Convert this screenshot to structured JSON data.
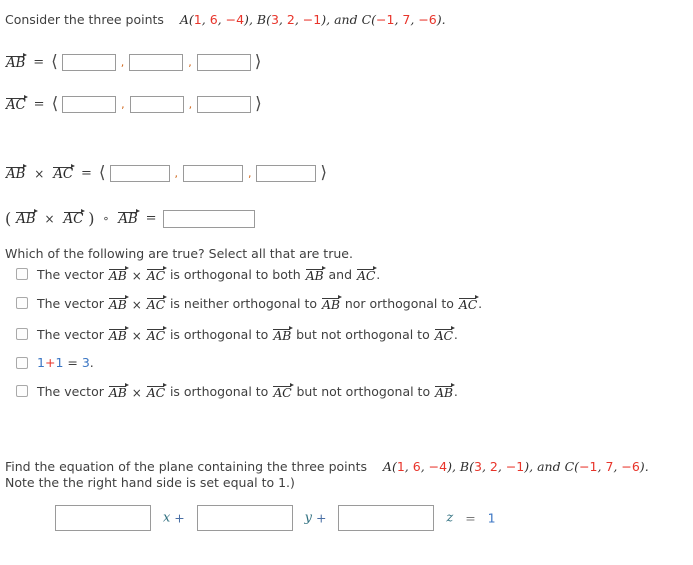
{
  "intro": {
    "prefix": "Consider the three points",
    "points": [
      {
        "name": "A",
        "coords": [
          "1",
          "6",
          "−4"
        ]
      },
      {
        "name": "B",
        "coords": [
          "3",
          "2",
          "−1"
        ]
      },
      {
        "name": "C",
        "coords": [
          "−1",
          "7",
          "−6"
        ]
      }
    ],
    "separator": ", ",
    "and_word": "and",
    "period": "."
  },
  "vectors": {
    "ab_label": "AB",
    "ac_label": "AC",
    "equals": "=",
    "times": "×",
    "dot": "∘",
    "open_angle": "⟨",
    "close_angle": "⟩",
    "comma": ",",
    "open_paren": "(",
    "close_paren": ")"
  },
  "rows": {
    "ab_row_name": "AB components",
    "ac_row_name": "AC components",
    "cross_row_name": "AB cross AC components",
    "dot_row_name": "cross dot AB"
  },
  "inputs": {
    "ab": [
      "",
      "",
      ""
    ],
    "ac": [
      "",
      "",
      ""
    ],
    "cross": [
      "",
      "",
      ""
    ],
    "dot": "",
    "plane": [
      "",
      "",
      ""
    ],
    "placeholder": ""
  },
  "question": {
    "prompt": "Which of the following are true? Select all that are true.",
    "options": [
      {
        "id": "opt-orthogonal-both",
        "pre": "The vector",
        "mid": "is orthogonal to both",
        "conj": "and",
        "end": "."
      },
      {
        "id": "opt-neither-orthogonal",
        "pre": "The vector",
        "mid": "is neither orthogonal to",
        "conj": "nor orthogonal to",
        "end": "."
      },
      {
        "id": "opt-ab-not-ac",
        "pre": "The vector",
        "mid": "is orthogonal to",
        "conj": "but not orthogonal to",
        "end": "."
      },
      {
        "id": "opt-arithmetic",
        "text_parts": [
          "1",
          "+",
          "1",
          " = ",
          "3",
          "."
        ]
      },
      {
        "id": "opt-ac-not-ab",
        "pre": "The vector",
        "mid": "is orthogonal to",
        "conj": "but not orthogonal to",
        "end": "."
      }
    ]
  },
  "plane": {
    "line1_prefix": "Find the equation of the plane containing the three points",
    "line2": "Note the the right hand side is set equal to 1.)",
    "x_label": "x",
    "y_label": "y",
    "z_label": "z",
    "plus": "+",
    "equals": "=",
    "rhs": "1"
  },
  "colors": {
    "number_red": "#e8342a",
    "number_blue": "#3b76c4",
    "text": "#3f3f3f",
    "box_border": "#9a9a9a",
    "comma_orange": "#d06a20",
    "var_teal": "#2f6f7f"
  }
}
